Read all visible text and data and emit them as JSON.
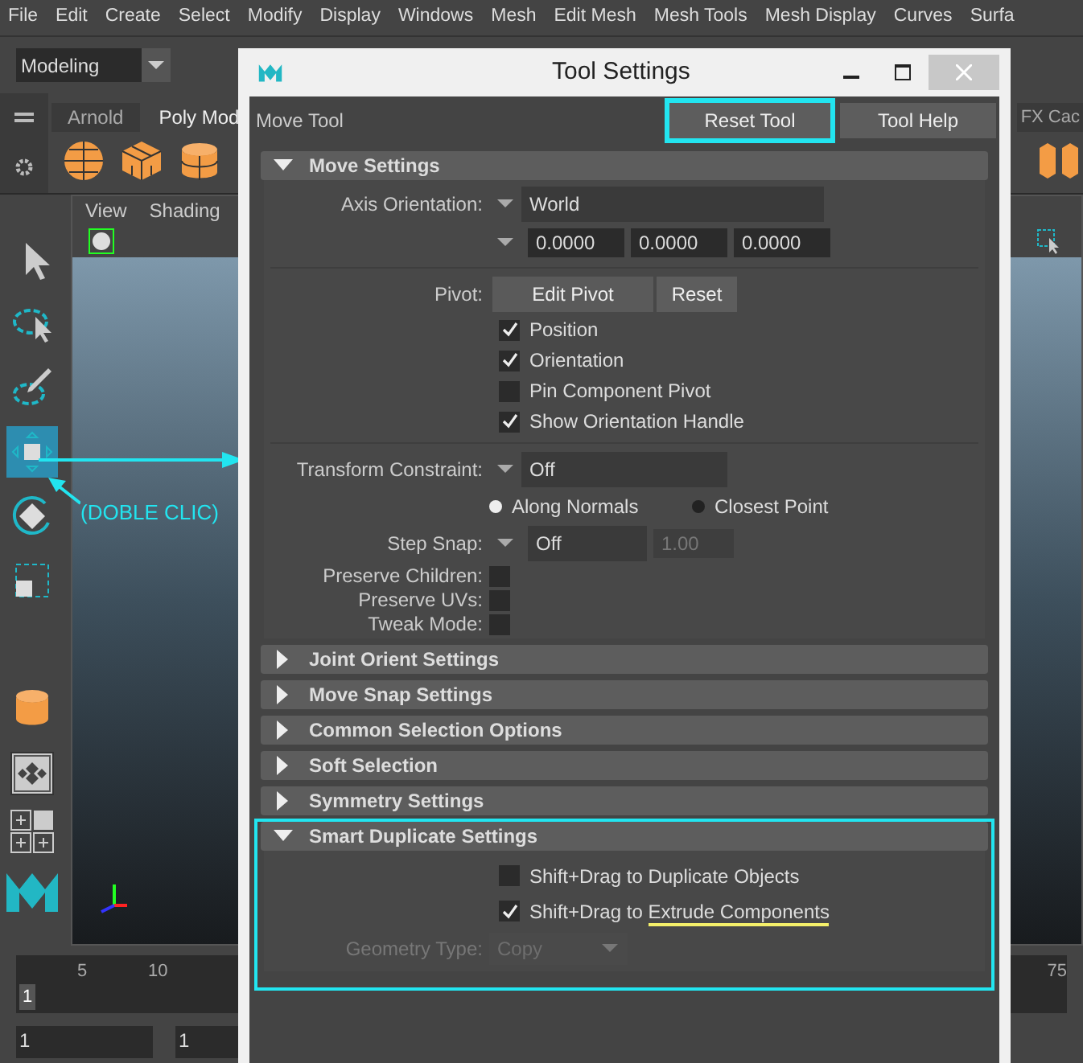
{
  "menu_bar": {
    "items": [
      "File",
      "Edit",
      "Create",
      "Select",
      "Modify",
      "Display",
      "Windows",
      "Mesh",
      "Edit Mesh",
      "Mesh Tools",
      "Mesh Display",
      "Curves",
      "Surfa"
    ]
  },
  "status_line": {
    "mode": "Modeling"
  },
  "shelf": {
    "tabs": [
      {
        "label": "Arnold",
        "selected": false
      },
      {
        "label": "Poly Mod",
        "selected": true
      },
      {
        "label": "FX Cac",
        "selected": false
      }
    ]
  },
  "viewport": {
    "menus": [
      "View",
      "Shading"
    ]
  },
  "timeline": {
    "ticks": [
      "5",
      "10"
    ],
    "right_tick": "75",
    "current_frame": "1",
    "range_fields": [
      "1",
      "1"
    ]
  },
  "annotation": {
    "text": "(DOBLE CLIC)"
  },
  "dialog": {
    "title": "Tool Settings",
    "tool_name": "Move Tool",
    "buttons": [
      {
        "label": "Reset Tool",
        "highlighted": true
      },
      {
        "label": "Tool Help",
        "highlighted": false
      }
    ],
    "sections": [
      {
        "title": "Move Settings",
        "expanded": true,
        "highlighted": false,
        "kind": "move",
        "axis_orientation": {
          "label": "Axis Orientation:",
          "value": "World",
          "values": [
            "0.0000",
            "0.0000",
            "0.0000"
          ]
        },
        "pivot": {
          "label": "Pivot:",
          "buttons": [
            "Edit Pivot",
            "Reset"
          ],
          "options": [
            {
              "label": "Position",
              "checked": true
            },
            {
              "label": "Orientation",
              "checked": true
            },
            {
              "label": "Pin Component Pivot",
              "checked": false
            },
            {
              "label": "Show Orientation Handle",
              "checked": true
            }
          ]
        },
        "transform_constraint": {
          "label": "Transform Constraint:",
          "value": "Off",
          "radios": [
            {
              "label": "Along Normals",
              "selected": true
            },
            {
              "label": "Closest Point",
              "selected": false
            }
          ]
        },
        "step_snap": {
          "label": "Step Snap:",
          "value": "Off",
          "amount": "1.00"
        },
        "flags": [
          {
            "label": "Preserve Children:",
            "checked": false
          },
          {
            "label": "Preserve UVs:",
            "checked": false
          },
          {
            "label": "Tweak Mode:",
            "checked": false
          }
        ]
      },
      {
        "title": "Joint Orient Settings",
        "expanded": false,
        "highlighted": false
      },
      {
        "title": "Move Snap Settings",
        "expanded": false,
        "highlighted": false
      },
      {
        "title": "Common Selection Options",
        "expanded": false,
        "highlighted": false
      },
      {
        "title": "Soft Selection",
        "expanded": false,
        "highlighted": false
      },
      {
        "title": "Symmetry Settings",
        "expanded": false,
        "highlighted": false
      },
      {
        "title": "Smart Duplicate Settings",
        "expanded": true,
        "highlighted": true,
        "kind": "duplicate",
        "options": [
          {
            "label": "Shift+Drag to Duplicate Objects",
            "checked": false
          },
          {
            "label": "Shift+Drag to",
            "underlined_part": "Extrude Components",
            "checked": true
          }
        ],
        "geometry_type": {
          "label": "Geometry Type:",
          "value": "Copy",
          "disabled": true
        }
      }
    ]
  }
}
